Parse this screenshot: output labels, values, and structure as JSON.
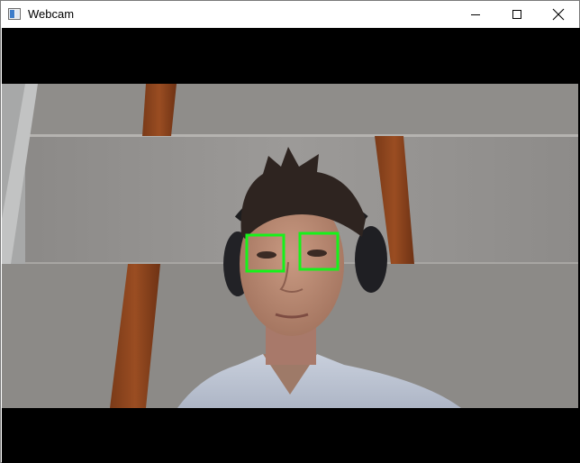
{
  "window": {
    "title": "Webcam",
    "icon": "app-window-icon",
    "controls": [
      "minimize-icon",
      "maximize-icon",
      "close-icon"
    ]
  },
  "feed": {
    "letterbox_color": "#000000",
    "detections": [
      {
        "label": "eye",
        "color": "#16f21a"
      },
      {
        "label": "eye",
        "color": "#16f21a"
      }
    ]
  }
}
